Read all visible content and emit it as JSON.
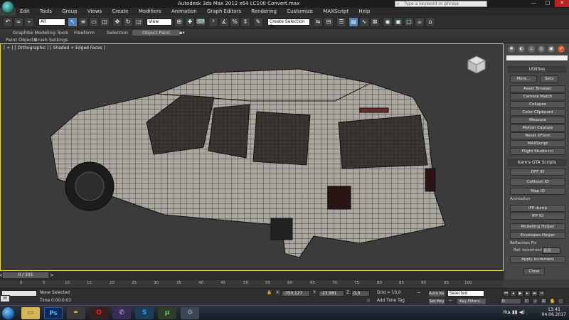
{
  "window": {
    "title": "Autodesk 3ds Max  2012 x64      LC100 Convert.max",
    "search_placeholder": "Type a keyword or phrase"
  },
  "menubar": [
    "Edit",
    "Tools",
    "Group",
    "Views",
    "Create",
    "Modifiers",
    "Animation",
    "Graph Editors",
    "Rendering",
    "Customize",
    "MAXScript",
    "Help"
  ],
  "toolbar": {
    "selection_filter": "All",
    "ref_coord": "View",
    "named_selection": "Create Selection Se"
  },
  "ribbon": {
    "tabs": [
      "Graphite Modeling Tools",
      "Freeform",
      "Selection",
      "Object Paint"
    ],
    "active_tab": "Object Paint",
    "subtabs": [
      "Paint Objects",
      "Brush Settings"
    ]
  },
  "viewport": {
    "label": "[ + ] [ Orthographic ] [ Shaded + Edged Faces ]"
  },
  "command_panel": {
    "utilities": {
      "title": "Utilities",
      "more": "More...",
      "sets": "Sets",
      "buttons": [
        "Asset Browser",
        "Camera Match",
        "Collapse",
        "Color Clipboard",
        "Measure",
        "Motion Capture",
        "Reset XForm",
        "MAXScript",
        "Flight Studio (c)"
      ]
    },
    "gta_scripts": {
      "title": "Kam's GTA Scripts",
      "buttons": [
        "DFF IO",
        "Collision IO",
        "Map IO"
      ],
      "animation_label": "Animation",
      "anim_buttons": [
        "IFP dump",
        "IFP IO"
      ],
      "helper_buttons": [
        "Modelling Helper",
        "Envelopes Helper"
      ],
      "reflection_label": "Reflection Fix",
      "ref_increment_label": "Ref. increment",
      "ref_increment_value": "0,0",
      "apply_button": "Apply increment",
      "close_button": "Close"
    }
  },
  "timeline": {
    "slider": "0 / 101",
    "ticks": [
      "0",
      "5",
      "10",
      "15",
      "20",
      "25",
      "30",
      "35",
      "40",
      "45",
      "50",
      "55",
      "60",
      "65",
      "70",
      "75",
      "80",
      "85",
      "90",
      "95",
      "100"
    ]
  },
  "status": {
    "selection": "None Selected",
    "prompt": "Time  0:00:0:03",
    "x_label": "X:",
    "x_value": "-350,127",
    "y_label": "Y:",
    "y_value": "-23,981",
    "z_label": "Z:",
    "z_value": "0,0",
    "grid": "Grid = 10,0",
    "add_time_tag": "Add Time Tag",
    "auto_key": "Auto Key",
    "auto_key_mode": "Selected",
    "set_key": "Set Key",
    "key_filters": "Key Filters...",
    "frame": "0",
    "maxscript_mini": "M"
  },
  "taskbar": {
    "lang": "RU",
    "time": "13:43",
    "date": "04.06.2017"
  }
}
